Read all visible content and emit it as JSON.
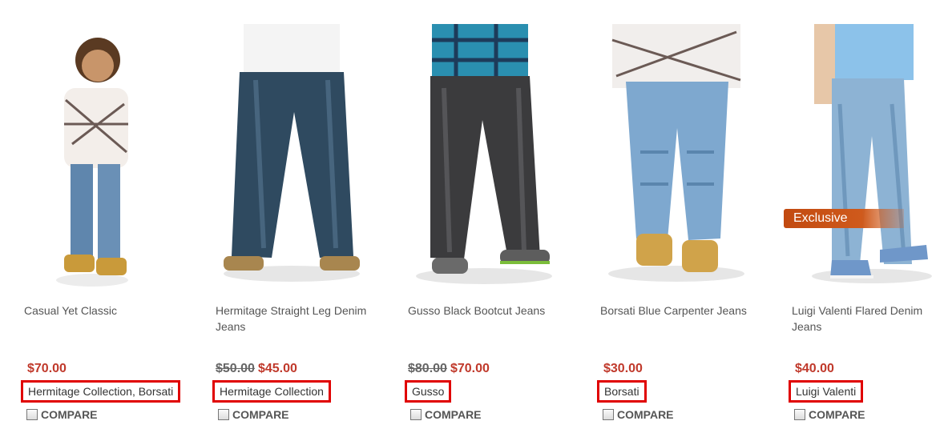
{
  "products": [
    {
      "title": "Casual Yet Classic",
      "old_price": "",
      "price": "$70.00",
      "brand": "Hermitage Collection, Borsati",
      "compare": "COMPARE",
      "badge": ""
    },
    {
      "title": "Hermitage Straight Leg Denim Jeans",
      "old_price": "$50.00",
      "price": "$45.00",
      "brand": "Hermitage Collection",
      "compare": "COMPARE",
      "badge": ""
    },
    {
      "title": "Gusso Black Bootcut Jeans",
      "old_price": "$80.00",
      "price": "$70.00",
      "brand": "Gusso",
      "compare": "COMPARE",
      "badge": ""
    },
    {
      "title": "Borsati Blue Carpenter Jeans",
      "old_price": "",
      "price": "$30.00",
      "brand": "Borsati",
      "compare": "COMPARE",
      "badge": ""
    },
    {
      "title": "Luigi Valenti Flared Denim Jeans",
      "old_price": "",
      "price": "$40.00",
      "brand": "Luigi Valenti",
      "compare": "COMPARE",
      "badge": "Exclusive"
    }
  ],
  "colors": {
    "price": "#c0392b",
    "highlight_border": "#e00000",
    "badge": "#c24a10"
  },
  "icons": {
    "compare": "checkbox-icon"
  }
}
